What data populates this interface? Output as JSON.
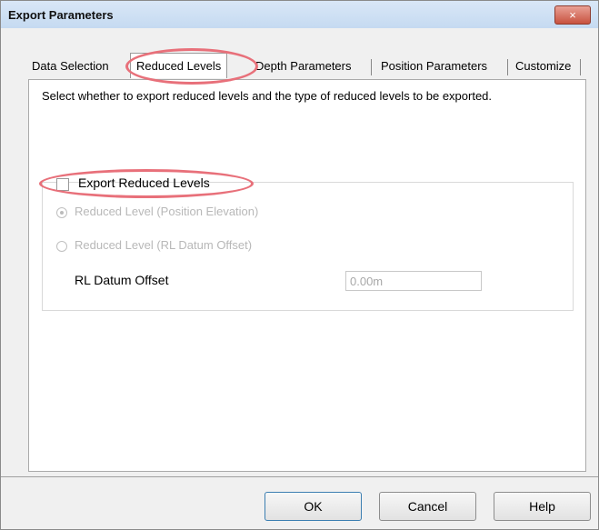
{
  "window": {
    "title": "Export Parameters",
    "close_label": "×"
  },
  "tabs": [
    {
      "label": "Data Selection"
    },
    {
      "label": "Reduced Levels"
    },
    {
      "label": "Depth Parameters"
    },
    {
      "label": "Position Parameters"
    },
    {
      "label": "Customize"
    }
  ],
  "panel": {
    "description": "Select whether to export reduced levels and the type of reduced levels to be exported.",
    "export_checkbox_label": "Export Reduced Levels",
    "radio_position_elevation": "Reduced Level (Position Elevation)",
    "radio_datum_offset": "Reduced Level (RL Datum Offset)",
    "datum_offset_label": "RL Datum Offset",
    "datum_offset_value": "0.00m"
  },
  "buttons": {
    "ok": "OK",
    "cancel": "Cancel",
    "help": "Help"
  }
}
